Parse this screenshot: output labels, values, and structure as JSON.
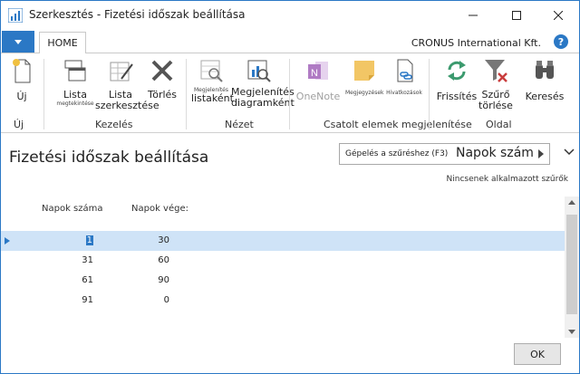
{
  "window": {
    "title": "Szerkesztés - Fizetési időszak beállítása"
  },
  "tabs": {
    "home": "HOME",
    "company": "CRONUS International Kft."
  },
  "help": {
    "label": "?"
  },
  "ribbon": {
    "new": {
      "label": "Új",
      "group": "Új"
    },
    "list": {
      "label": "Lista",
      "sub": "megtekintése"
    },
    "list_edit": {
      "label": "Lista",
      "label2": "szerkesztése"
    },
    "delete": {
      "label": "Törlés"
    },
    "group_manage": "Kezelés",
    "view_list": {
      "tiny": "Megjelenítés",
      "label": "listaként"
    },
    "view_chart": {
      "label": "Megjelenítés",
      "label2": "diagramként"
    },
    "group_view": "Nézet",
    "onenote": {
      "label": "OneNote"
    },
    "notes": {
      "tiny": "Megjegyzések"
    },
    "links": {
      "tiny": "Hivatkozások"
    },
    "group_attached": "Csatolt elemek megjelenítése",
    "refresh": {
      "label": "Frissítés"
    },
    "clear_filter": {
      "label": "Szűrő",
      "label2": "törlése"
    },
    "find": {
      "label": "Keresés"
    },
    "group_page": "Oldal"
  },
  "page": {
    "title": "Fizetési időszak beállítása",
    "filter_label": "Gépelés a szűréshez (F3)",
    "filter_field": "Napok száma",
    "no_filters": "Nincsenek alkalmazott szűrők"
  },
  "table": {
    "headers": [
      "Napok száma",
      "Napok vége:"
    ],
    "rows": [
      {
        "days": "1",
        "end": "30"
      },
      {
        "days": "31",
        "end": "60"
      },
      {
        "days": "61",
        "end": "90"
      },
      {
        "days": "91",
        "end": "0"
      }
    ]
  },
  "footer": {
    "ok": "OK"
  },
  "colors": {
    "accent": "#2b78c5",
    "selected_row": "#cfe3f7"
  }
}
